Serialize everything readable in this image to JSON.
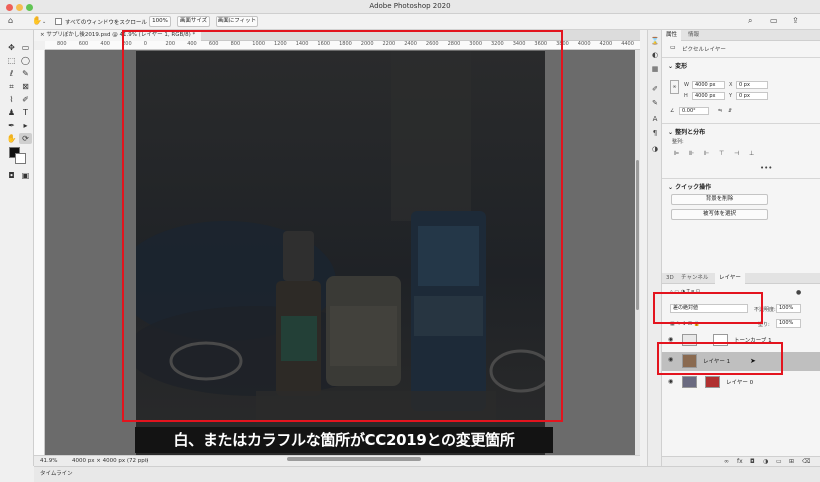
{
  "window": {
    "title": "Adobe Photoshop 2020",
    "traffic_colors": [
      "#ee5f57",
      "#f5bd4f",
      "#61c454"
    ]
  },
  "options_bar": {
    "scroll_all_label": "すべてのウィンドウをスクロール",
    "zoom_btn": "100%",
    "fit_screen_btn": "画面サイズ",
    "fill_screen_btn": "画面にフィット"
  },
  "document": {
    "tab_title": "サプリぼかし後2019.psd @ 41.9% (レイヤー 1, RGB/8) *",
    "ruler_ticks": [
      "800",
      "600",
      "400",
      "200",
      "0",
      "200",
      "400",
      "600",
      "800",
      "1000",
      "1200",
      "1400",
      "1600",
      "1800",
      "2000",
      "2200",
      "2400",
      "2600",
      "2800",
      "3000",
      "3200",
      "3400",
      "3600",
      "3800",
      "4000",
      "4200",
      "4400",
      "4600"
    ]
  },
  "status": {
    "zoom": "41.9%",
    "doc_size": "4000 px × 4000 px (72 ppi)"
  },
  "timeline": {
    "label": "タイムライン"
  },
  "caption": {
    "text": "白、またはカラフルな箇所がCC2019との変更箇所"
  },
  "properties_panel": {
    "tabs": [
      "属性",
      "情報"
    ],
    "kind_label": "ピクセルレイヤー",
    "transform_title": "変形",
    "w_label": "W",
    "w_value": "4000 px",
    "h_label": "H",
    "h_value": "4000 px",
    "x_label": "X",
    "x_value": "0 px",
    "y_label": "Y",
    "y_value": "0 px",
    "angle_value": "0.00°",
    "align_title": "整列と分布",
    "align_sub": "整列:",
    "quick_title": "クイック操作",
    "remove_bg_btn": "背景を削除",
    "select_subject_btn": "被写体を選択"
  },
  "layers_panel": {
    "tabs": [
      "3D",
      "チャンネル",
      "レイヤー"
    ],
    "blend_mode": "差の絶対値",
    "opacity_label": "不透明度:",
    "opacity_value": "100%",
    "fill_label": "塗り:",
    "fill_value": "100%",
    "layers": [
      {
        "name": "トーンカーブ 1"
      },
      {
        "name": "レイヤー 1"
      },
      {
        "name": "レイヤー 0"
      }
    ]
  },
  "annotation_color": "#e3141e"
}
